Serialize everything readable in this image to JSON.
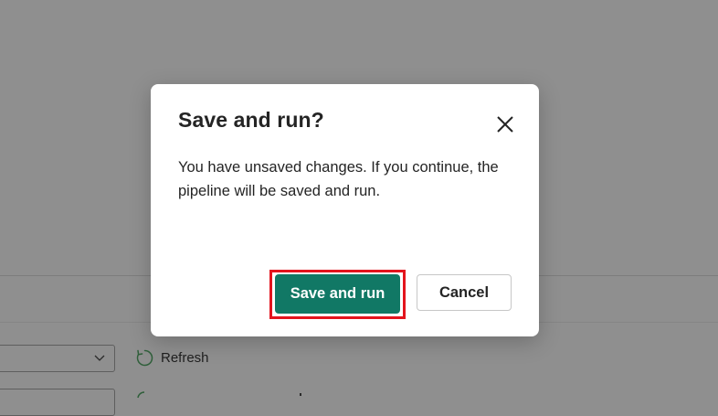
{
  "dialog": {
    "title": "Save and run?",
    "message": "You have unsaved changes. If you continue, the pipeline will be saved and run.",
    "primary_label": "Save and run",
    "cancel_label": "Cancel",
    "close_icon": "close-icon",
    "highlight_color": "#e3141d",
    "primary_color": "#117865"
  },
  "background": {
    "refresh_label": "Refresh",
    "refresh_icon": "refresh-icon",
    "dropdown_icon": "chevron-down-icon"
  }
}
